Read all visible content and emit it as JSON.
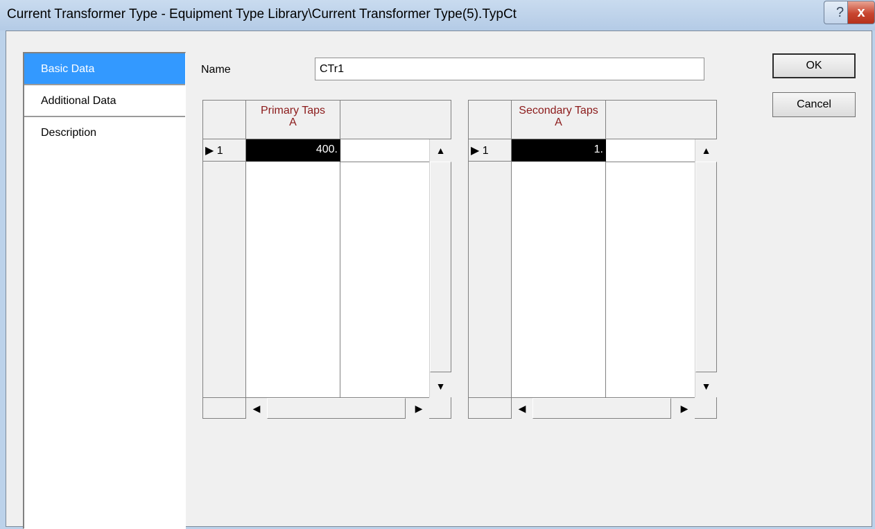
{
  "window": {
    "title": "Current Transformer Type - Equipment Type Library\\Current Transformer Type(5).TypCt",
    "help_glyph": "?",
    "close_glyph": "x"
  },
  "nav": {
    "items": [
      {
        "label": "Basic Data",
        "active": true
      },
      {
        "label": "Additional Data",
        "active": false
      },
      {
        "label": "Description",
        "active": false
      }
    ]
  },
  "form": {
    "name_label": "Name",
    "name_value": "CTr1"
  },
  "primary_grid": {
    "header_line1": "Primary Taps",
    "header_line2": "A",
    "rows": [
      {
        "row_label": "1",
        "value": "400."
      }
    ]
  },
  "secondary_grid": {
    "header_line1": "Secondary Taps",
    "header_line2": "A",
    "rows": [
      {
        "row_label": "1",
        "value": "1."
      }
    ]
  },
  "buttons": {
    "ok": "OK",
    "cancel": "Cancel"
  },
  "glyphs": {
    "row_pointer": "▶",
    "up": "▲",
    "down": "▼",
    "left": "◀",
    "right": "▶"
  }
}
